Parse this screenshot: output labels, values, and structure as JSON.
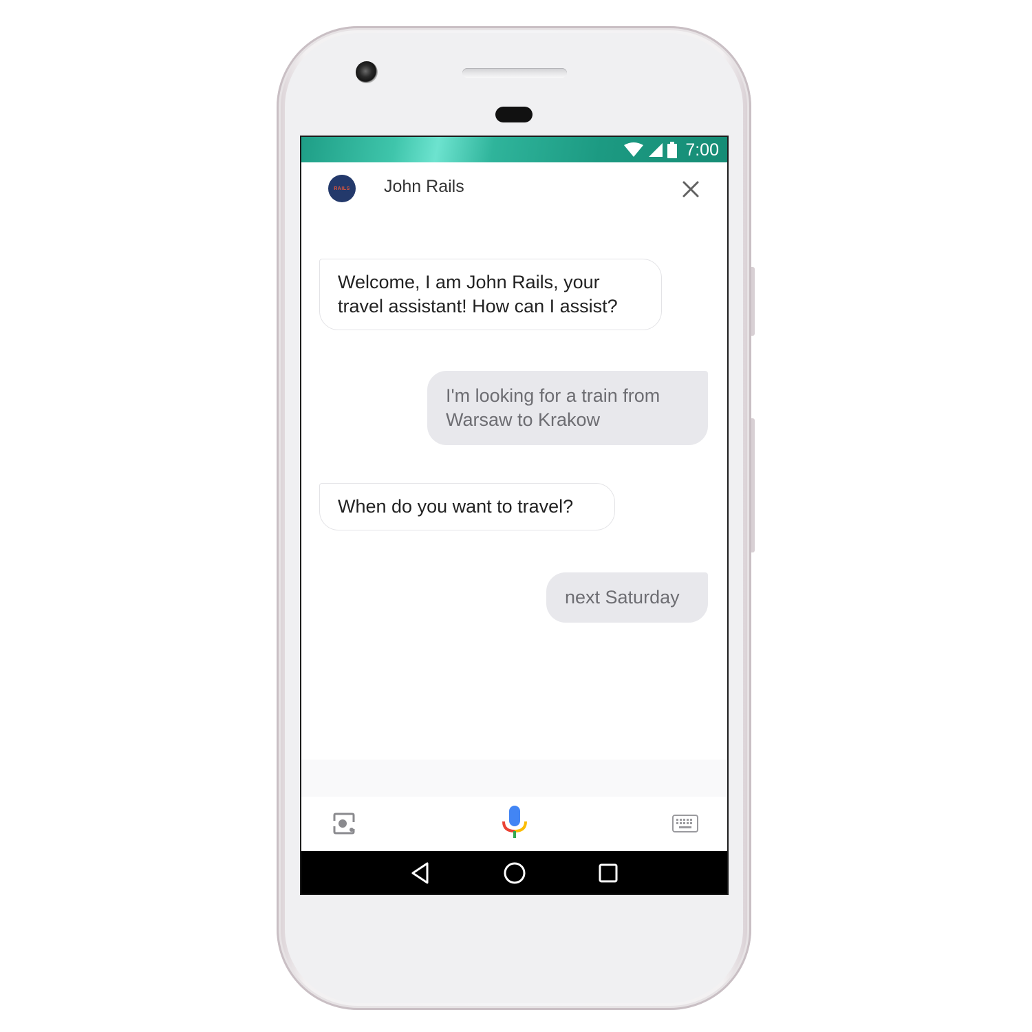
{
  "status_bar": {
    "time": "7:00",
    "wifi_icon": "wifi-icon",
    "signal_icon": "cell-signal-icon",
    "battery_icon": "battery-icon"
  },
  "header": {
    "avatar_text": "RAILS",
    "agent_name": "John Rails",
    "close_icon": "close-icon"
  },
  "messages": [
    {
      "sender": "bot",
      "text": "Welcome, I am John Rails, your travel assistant! How can I assist?"
    },
    {
      "sender": "user",
      "text": "I'm looking for a train from Warsaw to Krakow"
    },
    {
      "sender": "bot",
      "text": "When do you want to travel?"
    },
    {
      "sender": "user",
      "text": "next Saturday"
    }
  ],
  "input_bar": {
    "lens_icon": "lens-icon",
    "mic_icon": "microphone-icon",
    "keyboard_icon": "keyboard-icon"
  },
  "nav_bar": {
    "back_icon": "back-icon",
    "home_icon": "home-icon",
    "recents_icon": "recents-icon"
  },
  "colors": {
    "statusbar_accent": "#2fb49b",
    "avatar_bg": "#23396b",
    "user_bubble_bg": "#e8e8ec",
    "mic_blue": "#4285f4",
    "mic_red": "#ea4335",
    "mic_yellow": "#fbbc05",
    "mic_green": "#34a853"
  }
}
